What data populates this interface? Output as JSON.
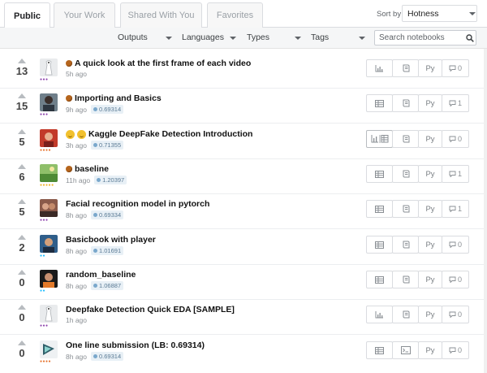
{
  "tabs": [
    {
      "label": "Public",
      "active": true
    },
    {
      "label": "Your Work",
      "active": false
    },
    {
      "label": "Shared With You",
      "active": false
    },
    {
      "label": "Favorites",
      "active": false
    }
  ],
  "sort": {
    "label": "Sort by",
    "value": "Hotness"
  },
  "filters": {
    "outputs": "Outputs",
    "languages": "Languages",
    "types": "Types",
    "tags": "Tags"
  },
  "search": {
    "placeholder": "Search notebooks"
  },
  "colors": {
    "tier_purple": "#8e44ad",
    "tier_orange": "#e6732e",
    "tier_teal": "#20beff",
    "tier_gold": "#f0b429",
    "medal_bronze": "#b5651d"
  },
  "rows": [
    {
      "votes": "13",
      "title": "A quick look at the first frame of each video",
      "badge": "medal",
      "time": "5h ago",
      "score": "",
      "tier": "purple",
      "tier_dots": "●●●",
      "avatar": "default",
      "output_icon": "chart-icon",
      "comments": "0"
    },
    {
      "votes": "15",
      "title": "Importing and Basics",
      "badge": "medal",
      "time": "9h ago",
      "score": "0.69314",
      "tier": "purple",
      "tier_dots": "●●●",
      "avatar": "person-dark",
      "output_icon": "table-icon",
      "comments": "1"
    },
    {
      "votes": "5",
      "title": "Kaggle DeepFake Detection Introduction",
      "badge": "emoji",
      "time": "3h ago",
      "score": "0.71355",
      "tier": "orange",
      "tier_dots": "●●●●",
      "avatar": "person-red",
      "output_icon": "chart-table-icon",
      "comments": "0"
    },
    {
      "votes": "6",
      "title": "baseline",
      "badge": "medal",
      "time": "11h ago",
      "score": "1.20397",
      "tier": "gold",
      "tier_dots": "●●●●●",
      "avatar": "landscape",
      "output_icon": "table-icon",
      "comments": "1"
    },
    {
      "votes": "5",
      "title": "Facial recognition model in pytorch",
      "badge": "",
      "time": "8h ago",
      "score": "0.69334",
      "tier": "purple",
      "tier_dots": "●●●",
      "avatar": "person-group",
      "output_icon": "table-icon",
      "comments": "1"
    },
    {
      "votes": "2",
      "title": "Basicbook with player",
      "badge": "",
      "time": "8h ago",
      "score": "1.01691",
      "tier": "teal",
      "tier_dots": "●●",
      "avatar": "person-blue",
      "output_icon": "table-icon",
      "comments": "0"
    },
    {
      "votes": "0",
      "title": "random_baseline",
      "badge": "",
      "time": "8h ago",
      "score": "1.06887",
      "tier": "teal",
      "tier_dots": "●●",
      "avatar": "person-night",
      "output_icon": "table-icon",
      "comments": "0"
    },
    {
      "votes": "0",
      "title": "Deepfake Detection Quick EDA [SAMPLE]",
      "badge": "",
      "time": "1h ago",
      "score": "",
      "tier": "purple",
      "tier_dots": "●●●",
      "avatar": "default",
      "output_icon": "chart-icon",
      "comments": "0"
    },
    {
      "votes": "0",
      "title": "One line submission (LB: 0.69314)",
      "badge": "",
      "time": "8h ago",
      "score": "0.69314",
      "tier": "orange",
      "tier_dots": "●●●●",
      "avatar": "terminal",
      "output_icon": "table-icon",
      "comments": "0",
      "type_icon": "terminal-icon"
    }
  ],
  "lang_label": "Py"
}
